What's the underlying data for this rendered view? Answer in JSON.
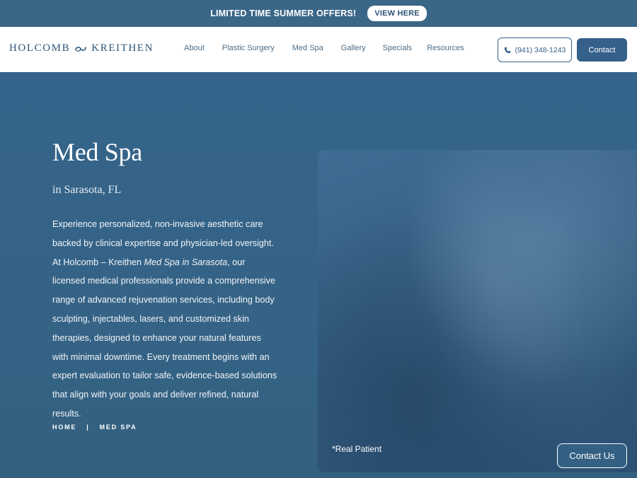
{
  "promo": {
    "text": "LIMITED TIME SUMMER OFFERS!",
    "button_label": "VIEW HERE"
  },
  "header": {
    "logo_left": "HOLCOMB",
    "logo_right": "KREITHEN",
    "logo_icon": "infinity-swirl-icon",
    "nav": [
      {
        "label": "About"
      },
      {
        "label": "Plastic Surgery"
      },
      {
        "label": "Med Spa"
      },
      {
        "label": "Gallery"
      },
      {
        "label": "Specials"
      },
      {
        "label": "Resources"
      }
    ],
    "phone_label": "(941) 348-1243",
    "phone_icon": "phone-icon",
    "contact_label": "Contact"
  },
  "hero": {
    "title": "Med Spa",
    "subtitle": "in Sarasota, FL",
    "body_before": "Experience personalized, non-invasive aesthetic care backed by clinical expertise and physician-led oversight. At Holcomb – Kreithen ",
    "body_em": "Med Spa in Sarasota",
    "body_after": ", our licensed medical professionals provide a comprehensive range of advanced rejuvenation services, including body sculpting, injectables, lasers, and customized skin therapies, designed to enhance your natural features with minimal downtime. Every treatment begins with an expert evaluation to tailor safe, evidence-based solutions that align with your goals and deliver refined, natural results.",
    "breadcrumb_home": "HOME",
    "breadcrumb_sep": "|",
    "breadcrumb_current": "MED SPA",
    "image_caption": "*Real Patient"
  },
  "floating_contact_label": "Contact Us",
  "colors": {
    "brand_blue": "#35608a",
    "hero_bg": "#356386",
    "header_bg": "#ffffff"
  }
}
